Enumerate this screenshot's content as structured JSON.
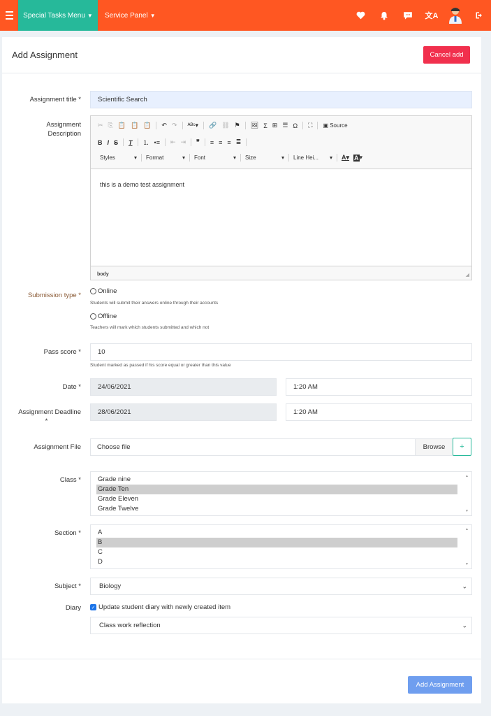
{
  "topbar": {
    "special_menu": "Special Tasks Menu",
    "service_panel": "Service Panel",
    "colors": {
      "bar": "#ff5722",
      "active_menu": "#26b99a"
    },
    "icons": [
      "heart-icon",
      "bell-icon",
      "chat-icon",
      "translate-icon",
      "user-avatar",
      "logout-icon"
    ]
  },
  "page": {
    "title": "Add Assignment",
    "cancel_label": "Cancel add"
  },
  "form": {
    "title_label": "Assignment title *",
    "title_value": "Scientific Search",
    "description_label_1": "Assignment",
    "description_label_2": "Description",
    "editor": {
      "source_label": "Source",
      "styles": "Styles",
      "format": "Format",
      "font": "Font",
      "size": "Size",
      "line_height": "Line Hei...",
      "content": "this is a demo test assignment",
      "path": "body"
    },
    "submission_label": "Submission type *",
    "online_label": "Online",
    "online_help": "Students will submit their answers online through their accounts",
    "offline_label": "Offline",
    "offline_help": "Teachers will mark which students submitted and which not",
    "pass_label": "Pass score *",
    "pass_value": "10",
    "pass_help": "Student marked as passed if his score equal or greater than this value",
    "date_label": "Date *",
    "date_value": "24/06/2021",
    "date_time": "1:20 AM",
    "deadline_label_1": "Assignment Deadline",
    "deadline_label_2": "*",
    "deadline_value": "28/06/2021",
    "deadline_time": "1:20 AM",
    "file_label": "Assignment File",
    "file_text": "Choose file",
    "browse_label": "Browse",
    "plus_label": "+",
    "class_label": "Class *",
    "class_options": [
      "Grade nine",
      "Grade Ten",
      "Grade Eleven",
      "Grade Twelve"
    ],
    "section_label": "Section *",
    "section_options": [
      "A",
      "B",
      "C",
      "D"
    ],
    "subject_label": "Subject *",
    "subject_value": "Biology",
    "diary_label": "Diary",
    "diary_check_label": "Update student diary with newly created item",
    "diary_select_value": "Class work reflection"
  },
  "footer": {
    "add_label": "Add Assignment"
  }
}
